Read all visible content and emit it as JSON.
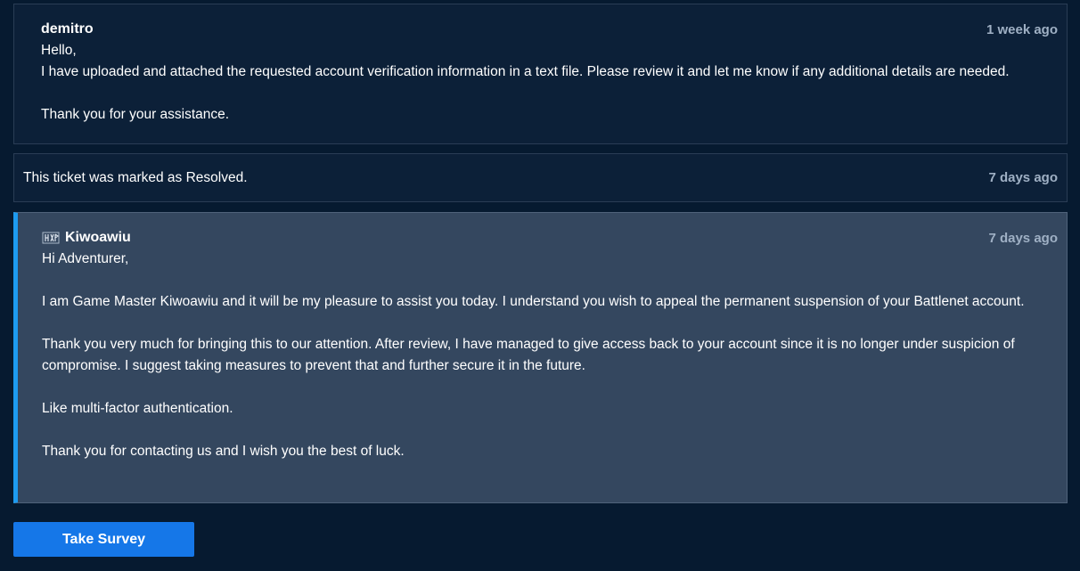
{
  "messages": [
    {
      "author": "demitro",
      "timestamp": "1 week ago",
      "paragraphs": [
        "Hello,",
        "I have uploaded and attached the requested account verification information in a text file. Please review it and let me know if any additional details are needed.",
        "",
        "Thank you for your assistance."
      ]
    },
    {
      "status_text": "This ticket was marked as Resolved.",
      "timestamp": "7 days ago"
    },
    {
      "author": "Kiwoawiu",
      "author_icon": "game-master-icon",
      "timestamp": "7 days ago",
      "paragraphs": [
        "Hi Adventurer,",
        "",
        "I am Game Master Kiwoawiu and it will be my pleasure to assist you today. I understand you wish to appeal the permanent suspension of your Battlenet account.",
        "",
        "Thank you very much for bringing this to our attention. After review, I have managed to give access back to your account since it is no longer under suspicion of compromise. I suggest taking measures to prevent that and further secure it in the future.",
        "",
        "Like multi-factor authentication.",
        "",
        "Thank you for contacting us and I wish you the best of luck."
      ]
    }
  ],
  "survey_button_label": "Take Survey",
  "colors": {
    "page_background": "#061a30",
    "card_background": "#0c2038",
    "gm_card_background": "#34475f",
    "accent": "#1d9bf0",
    "button": "#1577e8",
    "timestamp": "#9fb0c4"
  }
}
